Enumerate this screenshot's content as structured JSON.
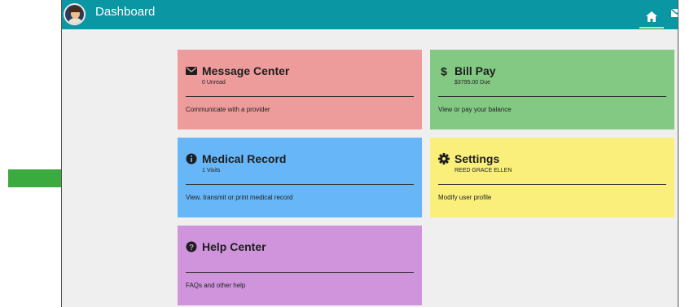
{
  "header": {
    "title": "Dashboard",
    "home_icon": "home-icon",
    "mail_icon": "mail-icon"
  },
  "cards": {
    "message_center": {
      "title": "Message Center",
      "subtitle": "0 Unread",
      "action": "Communicate with a provider",
      "icon": "envelope-icon",
      "color": "#ee9b9b"
    },
    "bill_pay": {
      "title": "Bill Pay",
      "subtitle": "$3795.00 Due",
      "action": "View or pay your balance",
      "icon": "dollar-icon",
      "color": "#83c984"
    },
    "medical_record": {
      "title": "Medical Record",
      "subtitle": "1 Visits",
      "action": "View, transmit or print medical record",
      "icon": "info-icon",
      "color": "#67b6f7"
    },
    "settings": {
      "title": "Settings",
      "subtitle": "REED GRACE ELLEN",
      "action": "Modify user profile",
      "icon": "gear-icon",
      "color": "#fbef7c"
    },
    "help_center": {
      "title": "Help Center",
      "subtitle": "",
      "action": "FAQs and other help",
      "icon": "question-icon",
      "color": "#cf94dc"
    }
  },
  "annotation": {
    "arrow_color": "#3cab3f",
    "arrow_icon": "right-arrow-icon"
  }
}
